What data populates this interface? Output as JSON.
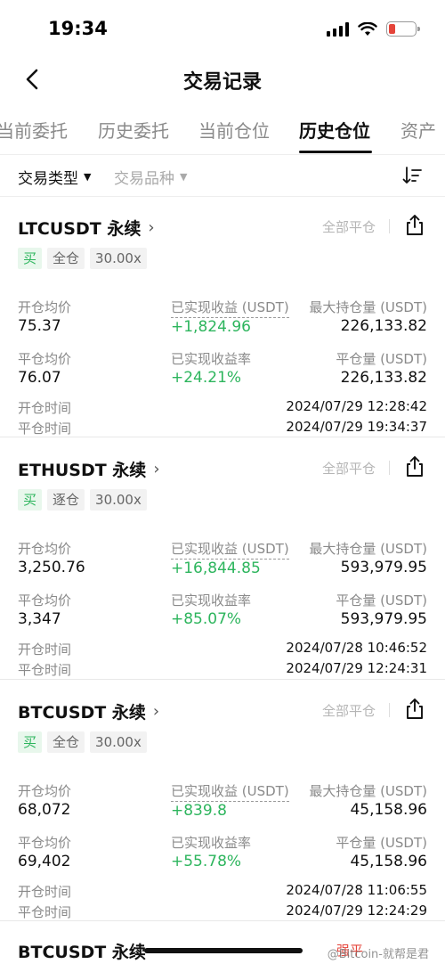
{
  "status": {
    "time": "19:34"
  },
  "header": {
    "title": "交易记录"
  },
  "tabs": [
    "当前委托",
    "历史委托",
    "当前仓位",
    "历史仓位",
    "资产"
  ],
  "filters": {
    "trade_type": "交易类型",
    "trade_symbol": "交易品种"
  },
  "labels": {
    "open_avg": "开仓均价",
    "close_avg": "平仓均价",
    "realized_pnl": "已实现收益 (USDT)",
    "realized_rate": "已实现收益率",
    "max_position": "最大持仓量 (USDT)",
    "close_amount": "平仓量 (USDT)",
    "open_time": "开仓时间",
    "close_time": "平仓时间",
    "close_all": "全部平仓"
  },
  "cards": [
    {
      "symbol": "LTCUSDT 永续",
      "side": "买",
      "margin": "全仓",
      "leverage": "30.00x",
      "open_avg": "75.37",
      "close_avg": "76.07",
      "pnl": "+1,824.96",
      "rate": "+24.21%",
      "max_position": "226,133.82",
      "close_amount": "226,133.82",
      "open_time": "2024/07/29 12:28:42",
      "close_time": "2024/07/29 19:34:37"
    },
    {
      "symbol": "ETHUSDT 永续",
      "side": "买",
      "margin": "逐仓",
      "leverage": "30.00x",
      "open_avg": "3,250.76",
      "close_avg": "3,347",
      "pnl": "+16,844.85",
      "rate": "+85.07%",
      "max_position": "593,979.95",
      "close_amount": "593,979.95",
      "open_time": "2024/07/28 10:46:52",
      "close_time": "2024/07/29 12:24:31"
    },
    {
      "symbol": "BTCUSDT 永续",
      "side": "买",
      "margin": "全仓",
      "leverage": "30.00x",
      "open_avg": "68,072",
      "close_avg": "69,402",
      "pnl": "+839.8",
      "rate": "+55.78%",
      "max_position": "45,158.96",
      "close_amount": "45,158.96",
      "open_time": "2024/07/28 11:06:55",
      "close_time": "2024/07/29 12:24:29"
    }
  ],
  "last_card": {
    "symbol": "BTCUSDT 永续",
    "badge": "强平"
  },
  "watermark": "@Bitcoin-就帮是君",
  "colors": {
    "profit": "#2db55d",
    "liquidation": "#e5443a",
    "muted": "#8a8a8a"
  }
}
